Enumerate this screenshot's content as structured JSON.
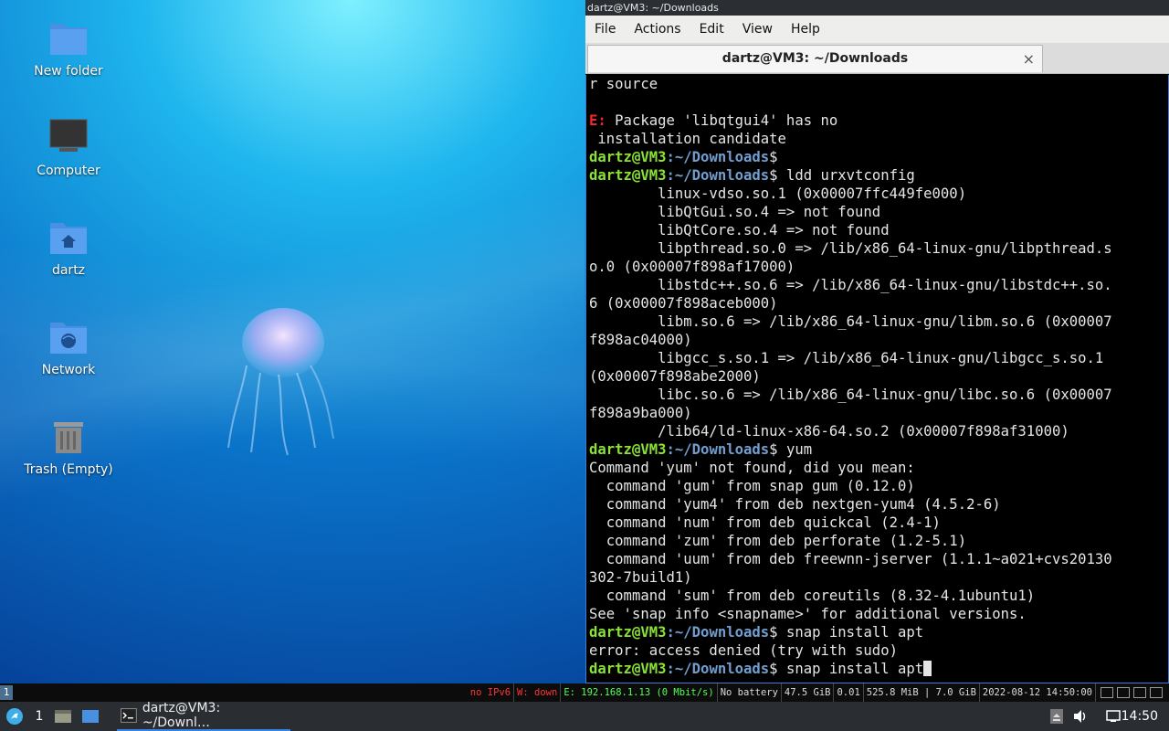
{
  "desktop": {
    "icons": [
      {
        "label": "New folder",
        "icon": "folder-icon"
      },
      {
        "label": "Computer",
        "icon": "computer-icon"
      },
      {
        "label": "dartz",
        "icon": "home-folder-icon"
      },
      {
        "label": "Network",
        "icon": "network-folder-icon"
      },
      {
        "label": "Trash (Empty)",
        "icon": "trash-icon"
      }
    ]
  },
  "terminal": {
    "window_title": "dartz@VM3: ~/Downloads",
    "menu": [
      "File",
      "Actions",
      "Edit",
      "View",
      "Help"
    ],
    "tab_title": "dartz@VM3: ~/Downloads",
    "tab_close": "×",
    "prompt_user": "dartz@VM3",
    "prompt_path": "~/Downloads",
    "error_prefix": "E:",
    "lines": [
      "r source",
      "",
      " Package 'libqtgui4' has no",
      " installation candidate",
      "",
      " ldd urxvtconfig",
      "        linux-vdso.so.1 (0x00007ffc449fe000)",
      "        libQtGui.so.4 => not found",
      "        libQtCore.so.4 => not found",
      "        libpthread.so.0 => /lib/x86_64-linux-gnu/libpthread.s",
      "o.0 (0x00007f898af17000)",
      "        libstdc++.so.6 => /lib/x86_64-linux-gnu/libstdc++.so.",
      "6 (0x00007f898aceb000)",
      "        libm.so.6 => /lib/x86_64-linux-gnu/libm.so.6 (0x00007",
      "f898ac04000)",
      "        libgcc_s.so.1 => /lib/x86_64-linux-gnu/libgcc_s.so.1",
      "(0x00007f898abe2000)",
      "        libc.so.6 => /lib/x86_64-linux-gnu/libc.so.6 (0x00007",
      "f898a9ba000)",
      "        /lib64/ld-linux-x86-64.so.2 (0x00007f898af31000)",
      " yum",
      "Command 'yum' not found, did you mean:",
      "  command 'gum' from snap gum (0.12.0)",
      "  command 'yum4' from deb nextgen-yum4 (4.5.2-6)",
      "  command 'num' from deb quickcal (2.4-1)",
      "  command 'zum' from deb perforate (1.2-5.1)",
      "  command 'uum' from deb freewnn-jserver (1.1.1~a021+cvs20130",
      "302-7build1)",
      "  command 'sum' from deb coreutils (8.32-4.1ubuntu1)",
      "See 'snap info <snapname>' for additional versions.",
      " snap install apt",
      "error: access denied (try with sudo)",
      " snap install apt"
    ]
  },
  "statusbar": {
    "workspace": "1",
    "ipv6": "no IPv6",
    "wifi": "W: down",
    "ethernet": "E: 192.168.1.13 (0 Mbit/s)",
    "battery": "No battery",
    "disk": "47.5 GiB",
    "load": "0.01",
    "memory": "525.8 MiB | 7.0 GiB",
    "datetime": "2022-08-12 14:50:00"
  },
  "taskbar": {
    "workspace": "1",
    "task_label": "dartz@VM3: ~/Downl…",
    "clock": "14:50"
  }
}
